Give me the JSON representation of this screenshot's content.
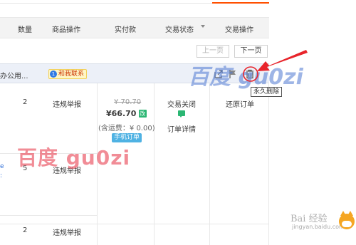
{
  "header": {
    "col_qty": "数量",
    "col_item_actions": "商品操作",
    "col_paid": "实付款",
    "col_status": "交易状态",
    "col_order_actions": "交易操作"
  },
  "pager": {
    "prev": "上一页",
    "next": "下一页"
  },
  "order": {
    "seller_fragment": "办公用...",
    "contact_badge": "1",
    "contact_label": "和我联系",
    "delete_tooltip": "永久删除",
    "items": [
      {
        "qty": "2",
        "action": "违规举报"
      },
      {
        "qty": "5",
        "action": "违规举报"
      },
      {
        "qty": "2",
        "action": "违规举报"
      }
    ],
    "original_price": "¥ 70.70",
    "paid_price": "¥66.70",
    "price_badge": "改",
    "shipping": "(含运费：¥ 0.00)",
    "mobile_tag": "手机订单",
    "status_closed": "交易关闭",
    "order_detail": "订单详情",
    "restore_order": "还原订单"
  },
  "watermarks": {
    "red": "百度 gu0zi",
    "blue": "百度 gu0zi"
  },
  "baidu_logo": {
    "title": "Bai 经验",
    "url": "jingyan.baidu.com"
  },
  "colors": {
    "accent_orange": "#ff5000",
    "header_bg": "#f3f3f3",
    "order_bar_bg": "#ecf0f8",
    "annotation_red": "#e8242b",
    "mobile_tag": "#4fb2e3"
  },
  "icons": [
    "share-icon",
    "flag-icon",
    "trash-icon",
    "chat-icon",
    "red-arrow-annotation",
    "red-circle-annotation"
  ]
}
